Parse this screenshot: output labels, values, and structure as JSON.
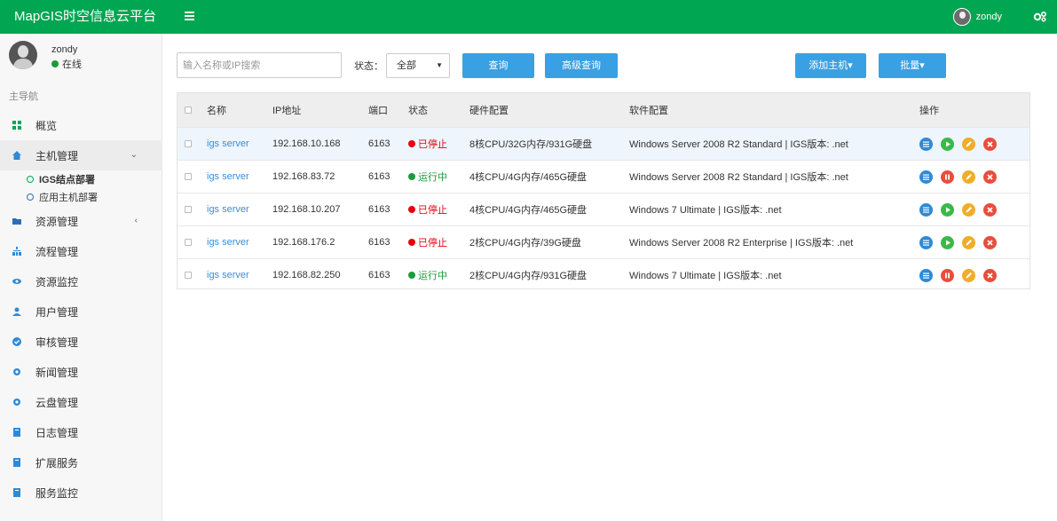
{
  "colors": {
    "brand": "#00a651",
    "accent": "#3aa0e4",
    "stopped": "#e60012",
    "running": "#1a9b3a",
    "link": "#3a8dd8"
  },
  "header": {
    "brand": "MapGIS时空信息云平台",
    "username": "zondy"
  },
  "sidebar": {
    "user": {
      "name": "zondy",
      "status": "在线"
    },
    "nav_header": "主导航",
    "items": [
      {
        "label": "概览",
        "icon": "dashboard-icon"
      },
      {
        "label": "主机管理",
        "icon": "home-icon",
        "arrow": "⌄"
      },
      {
        "label": "资源管理",
        "icon": "folder-icon",
        "arrow": "‹"
      },
      {
        "label": "流程管理",
        "icon": "sitemap-icon"
      },
      {
        "label": "资源监控",
        "icon": "eye-icon"
      },
      {
        "label": "用户管理",
        "icon": "user-icon"
      },
      {
        "label": "审核管理",
        "icon": "check-circle-icon"
      },
      {
        "label": "新闻管理",
        "icon": "gear-icon"
      },
      {
        "label": "云盘管理",
        "icon": "gear-icon"
      },
      {
        "label": "日志管理",
        "icon": "book-icon"
      },
      {
        "label": "扩展服务",
        "icon": "book-icon"
      },
      {
        "label": "服务监控",
        "icon": "book-icon"
      }
    ],
    "sub_items": [
      {
        "label": "IGS结点部署",
        "active": true
      },
      {
        "label": "应用主机部署",
        "active": false
      }
    ]
  },
  "toolbar": {
    "search_placeholder": "输入名称或IP搜索",
    "status_label": "状态：",
    "status_value": "全部",
    "query_label": "查询",
    "advanced_label": "高级查询",
    "add_label": "添加主机▾",
    "batch_label": "批量▾"
  },
  "table": {
    "columns": {
      "name": "名称",
      "ip": "IP地址",
      "port": "端口",
      "state": "状态",
      "hw": "硬件配置",
      "sw": "软件配置",
      "ops": "操作"
    },
    "rows": [
      {
        "name": "igs server",
        "ip": "192.168.10.168",
        "port": "6163",
        "state": "已停止",
        "running": false,
        "hw": "8核CPU/32G内存/931G硬盘",
        "sw": "Windows Server 2008 R2 Standard | IGS版本: .net"
      },
      {
        "name": "igs server",
        "ip": "192.168.83.72",
        "port": "6163",
        "state": "运行中",
        "running": true,
        "hw": "4核CPU/4G内存/465G硬盘",
        "sw": "Windows Server 2008 R2 Standard | IGS版本: .net"
      },
      {
        "name": "igs server",
        "ip": "192.168.10.207",
        "port": "6163",
        "state": "已停止",
        "running": false,
        "hw": "4核CPU/4G内存/465G硬盘",
        "sw": "Windows 7 Ultimate | IGS版本: .net"
      },
      {
        "name": "igs server",
        "ip": "192.168.176.2",
        "port": "6163",
        "state": "已停止",
        "running": false,
        "hw": "2核CPU/4G内存/39G硬盘",
        "sw": "Windows Server 2008 R2 Enterprise | IGS版本: .net"
      },
      {
        "name": "igs server",
        "ip": "192.168.82.250",
        "port": "6163",
        "state": "运行中",
        "running": true,
        "hw": "2核CPU/4G内存/931G硬盘",
        "sw": "Windows 7 Ultimate | IGS版本: .net"
      }
    ]
  }
}
